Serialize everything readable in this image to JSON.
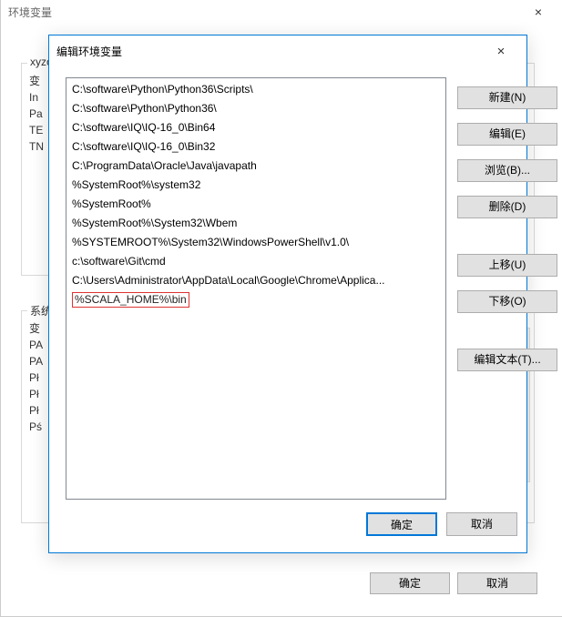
{
  "bgDialog": {
    "title": "环境变量",
    "close": "×",
    "upperGroup": {
      "labelPrefix": "xyzc",
      "lines": [
        "变",
        "In",
        "Pa",
        "TE",
        "TN"
      ]
    },
    "lowerGroup": {
      "labelPrefix": "系统",
      "lines": [
        "变",
        "PA",
        "PA",
        "Pł",
        "Pł",
        "Pł",
        "Pś"
      ]
    },
    "ok": "确定",
    "cancel": "取消"
  },
  "fgDialog": {
    "title": "编辑环境变量",
    "close": "×",
    "entries": [
      "C:\\software\\Python\\Python36\\Scripts\\",
      "C:\\software\\Python\\Python36\\",
      "C:\\software\\IQ\\IQ-16_0\\Bin64",
      "C:\\software\\IQ\\IQ-16_0\\Bin32",
      "C:\\ProgramData\\Oracle\\Java\\javapath",
      "%SystemRoot%\\system32",
      "%SystemRoot%",
      "%SystemRoot%\\System32\\Wbem",
      "%SYSTEMROOT%\\System32\\WindowsPowerShell\\v1.0\\",
      "c:\\software\\Git\\cmd",
      "C:\\Users\\Administrator\\AppData\\Local\\Google\\Chrome\\Applica...",
      "%SCALA_HOME%\\bin"
    ],
    "highlightIndex": 11,
    "buttons": {
      "new": "新建(N)",
      "edit": "编辑(E)",
      "browse": "浏览(B)...",
      "delete": "删除(D)",
      "moveUp": "上移(U)",
      "moveDown": "下移(O)",
      "editText": "编辑文本(T)..."
    },
    "ok": "确定",
    "cancel": "取消"
  }
}
